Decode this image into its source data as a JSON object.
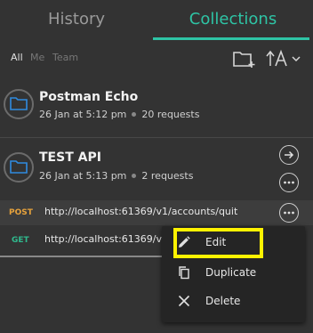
{
  "tabs": {
    "history": "History",
    "collections": "Collections"
  },
  "filters": {
    "all": "All",
    "me": "Me",
    "team": "Team"
  },
  "collections": [
    {
      "name": "Postman Echo",
      "date": "26 Jan at 5:12 pm",
      "count": "20 requests"
    },
    {
      "name": "TEST API",
      "date": "26 Jan at 5:13 pm",
      "count": "2 requests"
    }
  ],
  "requests": [
    {
      "method": "POST",
      "url": "http://localhost:61369/v1/accounts/quit"
    },
    {
      "method": "GET",
      "url": "http://localhost:61369/v1/"
    }
  ],
  "menu": {
    "edit": "Edit",
    "duplicate": "Duplicate",
    "delete": "Delete"
  },
  "colors": {
    "background": "#333333",
    "accent": "#2ec4a5",
    "post": "#e6a23c",
    "get": "#2fb98d",
    "highlight": "#fff200"
  }
}
